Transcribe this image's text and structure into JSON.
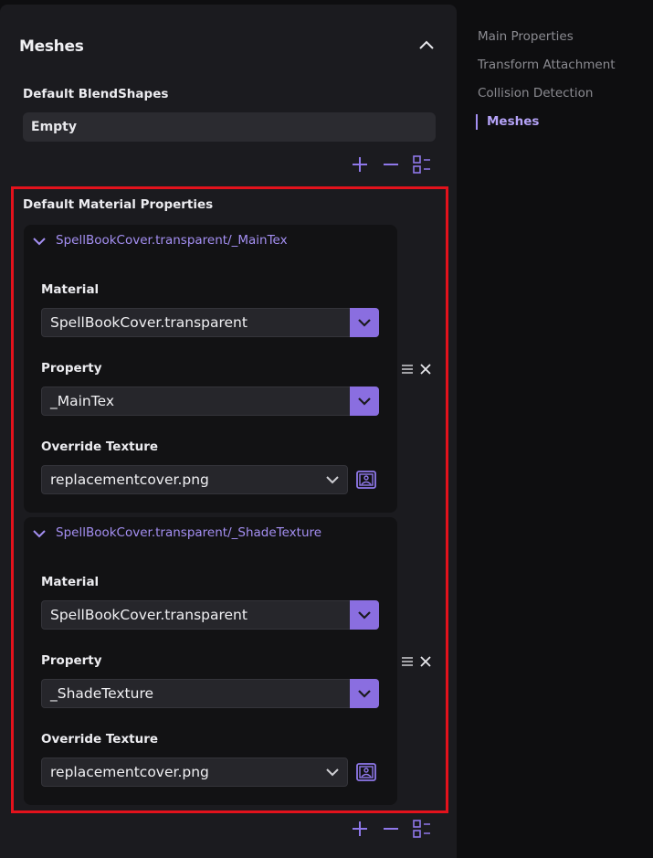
{
  "panel": {
    "title": "Meshes",
    "blendshapes": {
      "label": "Default BlendShapes",
      "value": "Empty"
    },
    "materials": {
      "label": "Default Material Properties",
      "items": [
        {
          "header": "SpellBookCover.transparent/_MainTex",
          "material_label": "Material",
          "material_value": "SpellBookCover.transparent",
          "property_label": "Property",
          "property_value": "_MainTex",
          "override_label": "Override Texture",
          "override_value": "replacementcover.png"
        },
        {
          "header": "SpellBookCover.transparent/_ShadeTexture",
          "material_label": "Material",
          "material_value": "SpellBookCover.transparent",
          "property_label": "Property",
          "property_value": "_ShadeTexture",
          "override_label": "Override Texture",
          "override_value": "replacementcover.png"
        }
      ]
    }
  },
  "nav": {
    "items": [
      {
        "label": "Main Properties",
        "active": false
      },
      {
        "label": "Transform Attachment",
        "active": false
      },
      {
        "label": "Collision Detection",
        "active": false
      },
      {
        "label": "Meshes",
        "active": true
      }
    ]
  },
  "icons": [
    "chevron-up-icon",
    "plus-icon",
    "minus-icon",
    "grid-icon",
    "chevron-down-icon",
    "hamburger-icon",
    "close-icon",
    "image-icon"
  ],
  "colors": {
    "accent": "#8a6ee0",
    "accent_text": "#a48ff2",
    "highlight": "#e3121c",
    "panel": "#1b1b1f",
    "background": "#0e0e10"
  }
}
